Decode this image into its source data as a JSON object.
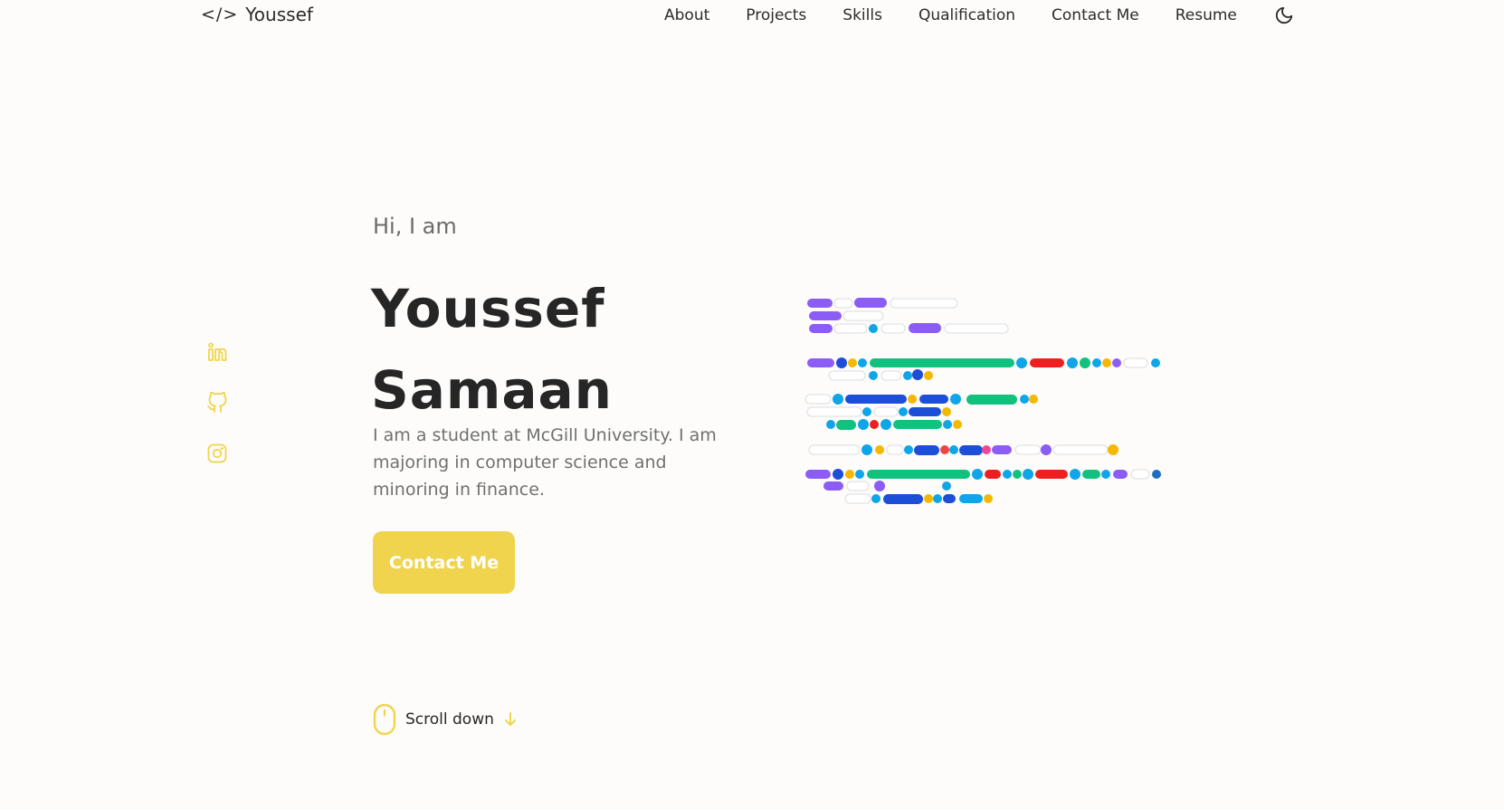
{
  "header": {
    "logo_text": "Youssef",
    "logo_icon": "code-brackets-icon",
    "nav": [
      {
        "label": "About"
      },
      {
        "label": "Projects"
      },
      {
        "label": "Skills"
      },
      {
        "label": "Qualification"
      },
      {
        "label": "Contact Me"
      },
      {
        "label": "Resume"
      }
    ],
    "theme_toggle_icon": "moon-icon"
  },
  "social": [
    {
      "icon": "linkedin-icon"
    },
    {
      "icon": "github-icon"
    },
    {
      "icon": "instagram-icon"
    }
  ],
  "hero": {
    "greeting": "Hi, I am",
    "first_name": "Youssef",
    "last_name": "Samaan",
    "description": "I am a student at McGill University. I am majoring in computer science and minoring in finance.",
    "cta_label": "Contact Me"
  },
  "scroll": {
    "label": "Scroll down",
    "icon": "mouse-icon",
    "arrow_icon": "arrow-down-icon"
  },
  "colors": {
    "accent": "#f0d44e",
    "background": "#fdfcfa",
    "heading": "#262626",
    "muted": "#707070"
  }
}
